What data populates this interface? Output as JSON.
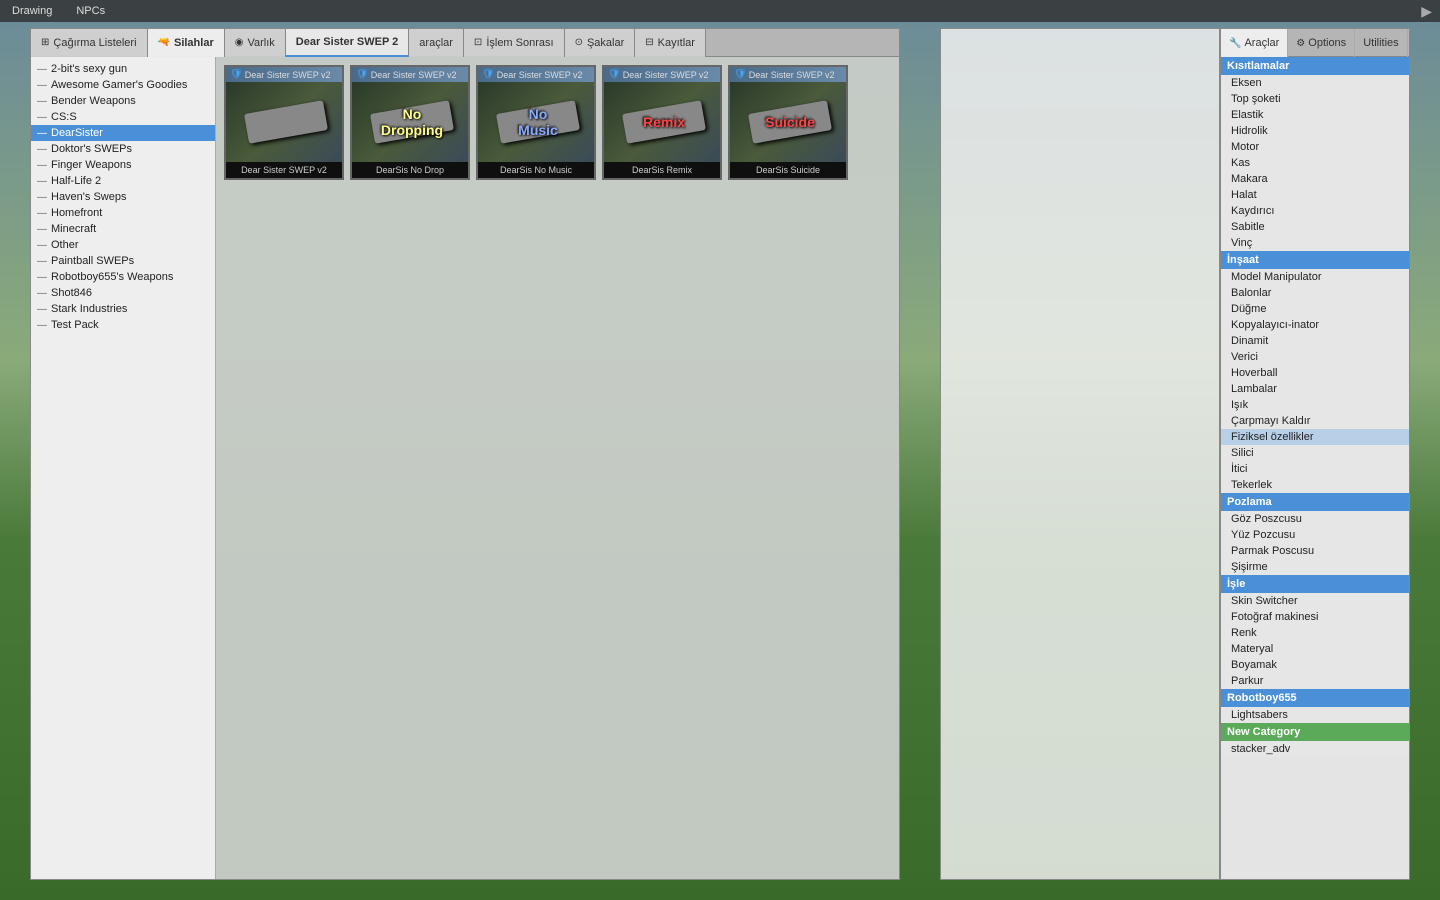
{
  "topMenu": {
    "items": [
      "Drawing",
      "NPCs"
    ],
    "arrowLabel": "▶"
  },
  "tabs": [
    {
      "id": "cagirma",
      "icon": "⊞",
      "label": "Çağırma Listeleri"
    },
    {
      "id": "silahlar",
      "icon": "🔫",
      "label": "Silahlar",
      "active": true
    },
    {
      "id": "varlik",
      "icon": "◉",
      "label": "Varlık"
    },
    {
      "id": "dear-sister",
      "icon": "",
      "label": "Dear Sister SWEP 2",
      "active-tab": true
    },
    {
      "id": "araclar-tab",
      "icon": "",
      "label": "araçlar"
    },
    {
      "id": "islem",
      "icon": "⊡",
      "label": "İşlem Sonrası"
    },
    {
      "id": "sakalar",
      "icon": "⊙",
      "label": "Şakalar"
    },
    {
      "id": "kayitlar",
      "icon": "⊟",
      "label": "Kayıtlar"
    }
  ],
  "weaponList": [
    {
      "label": "2-bit's sexy gun",
      "selected": false
    },
    {
      "label": "Awesome Gamer's Goodies",
      "selected": false
    },
    {
      "label": "Bender Weapons",
      "selected": false
    },
    {
      "label": "CS:S",
      "selected": false
    },
    {
      "label": "DearSister",
      "selected": true
    },
    {
      "label": "Doktor's SWEPs",
      "selected": false
    },
    {
      "label": "Finger Weapons",
      "selected": false
    },
    {
      "label": "Half-Life 2",
      "selected": false
    },
    {
      "label": "Haven's Sweps",
      "selected": false
    },
    {
      "label": "Homefront",
      "selected": false
    },
    {
      "label": "Minecraft",
      "selected": false
    },
    {
      "label": "Other",
      "selected": false
    },
    {
      "label": "Paintball SWEPs",
      "selected": false
    },
    {
      "label": "Robotboy655's Weapons",
      "selected": false
    },
    {
      "label": "Shot846",
      "selected": false
    },
    {
      "label": "Stark Industries",
      "selected": false
    },
    {
      "label": "Test Pack",
      "selected": false
    }
  ],
  "weaponCards": [
    {
      "title": "Dear Sister SWEP v2",
      "overlayText": "",
      "footerText": "Dear Sister SWEP v2",
      "overlayClass": ""
    },
    {
      "title": "Dear Sister SWEP v2",
      "overlayText": "No Dropping",
      "footerText": "DearSis No Drop",
      "overlayClass": "no-dropping"
    },
    {
      "title": "Dear Sister SWEP v2",
      "overlayText": "No Music",
      "footerText": "DearSis No Music",
      "overlayClass": "no-music"
    },
    {
      "title": "Dear Sister SWEP v2",
      "overlayText": "Remix",
      "footerText": "DearSis Remix",
      "overlayClass": "remix"
    },
    {
      "title": "Dear Sister SWEP v2",
      "overlayText": "Suicide",
      "footerText": "DearSis Suicide",
      "overlayClass": "suicide"
    }
  ],
  "rightPanel": {
    "tabs": [
      {
        "label": "Araçlar",
        "icon": "🔧",
        "active": true
      },
      {
        "label": "Options",
        "icon": "⚙"
      },
      {
        "label": "Utilities",
        "icon": "🔨"
      }
    ],
    "categories": [
      {
        "header": "Kısıtlamalar",
        "items": [
          "Eksen",
          "Top şoketi",
          "Elastik",
          "Hidrolik",
          "Motor",
          "Kas",
          "Makara",
          "Halat",
          "Kaydırıcı",
          "Sabitle",
          "Vinç"
        ]
      },
      {
        "header": "İnşaat",
        "items": [
          "Model Manipulator",
          "Balonlar",
          "Düğme",
          "Kopyalayıcı-inator",
          "Dinamit",
          "Verici",
          "Hoverball",
          "Lambalar",
          "Işık",
          "Çarpmayı Kaldır",
          "Fiziksel özellikler",
          "Silici",
          "İtici",
          "Tekerlek"
        ]
      },
      {
        "header": "Pozlama",
        "items": [
          "Göz Poszcusu",
          "Yüz Pozcusu",
          "Parmak Poscusu",
          "Şişirme"
        ]
      },
      {
        "header": "İşle",
        "items": [
          "Skin Switcher",
          "Fotoğraf makinesi",
          "Renk",
          "Materyal",
          "Boyamak",
          "Parkur"
        ]
      },
      {
        "header": "Robotboy655",
        "items": [
          "Lightsabers"
        ]
      },
      {
        "header": "New Category",
        "items": [
          "stacker_adv"
        ]
      }
    ],
    "highlightedItems": [
      "Fiziksel özellikler"
    ]
  }
}
